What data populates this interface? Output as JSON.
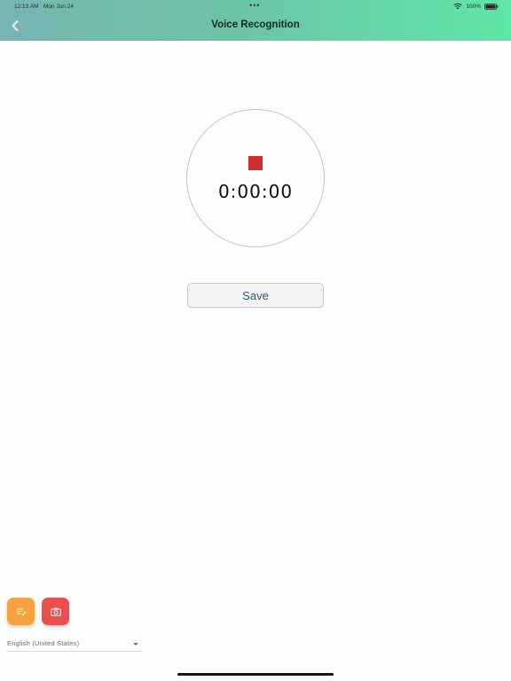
{
  "status_bar": {
    "time": "12:13 AM",
    "date": "Mon Jun 24",
    "dots": "•••",
    "battery": "100%"
  },
  "header": {
    "title": "Voice Recognition",
    "back_icon": "chevron-left-icon",
    "gradient_colors": [
      "#78b5b1",
      "#5ee6a6"
    ]
  },
  "recorder": {
    "timer": "0:00:00",
    "stop_icon": "stop-square-icon",
    "stop_color": "#d42e2e"
  },
  "actions": {
    "save_label": "Save"
  },
  "bottom": {
    "notes_icon": "notes-icon",
    "notes_color": "#f6a23e",
    "camera_icon": "camera-icon",
    "camera_color": "#ec4e50",
    "language": "English (United States)"
  }
}
